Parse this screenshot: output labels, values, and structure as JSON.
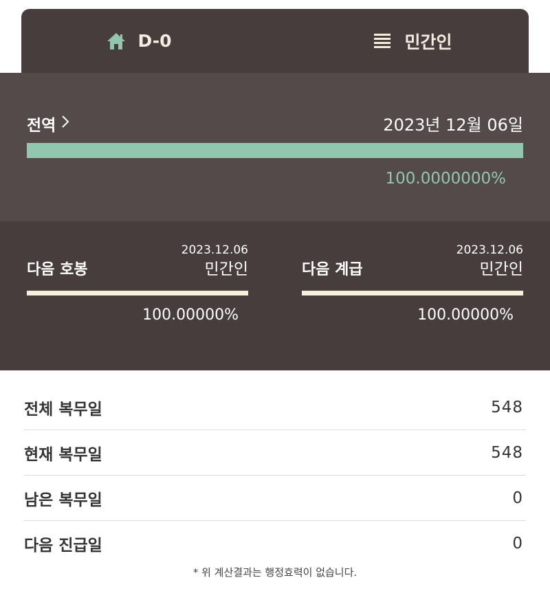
{
  "tabs": {
    "dday": {
      "label": "D-0",
      "icon": "home-icon"
    },
    "status": {
      "label": "민간인",
      "icon": "list-icon"
    }
  },
  "colors": {
    "accent_green": "#91c7ae",
    "panel_dark": "#473d3d",
    "panel_mid": "#544a4a",
    "cream": "#f7efdc"
  },
  "main": {
    "title": "전역",
    "date": "2023년 12월 06일",
    "progress_percent": 100,
    "progress_text": "100.0000000%"
  },
  "next_pay": {
    "title": "다음 호봉",
    "date": "2023.12.06",
    "status": "민간인",
    "progress_percent": 100,
    "progress_text": "100.00000%"
  },
  "next_rank": {
    "title": "다음 계급",
    "date": "2023.12.06",
    "status": "민간인",
    "progress_percent": 100,
    "progress_text": "100.00000%"
  },
  "stats": [
    {
      "label": "전체 복무일",
      "value": "548"
    },
    {
      "label": "현재 복무일",
      "value": "548"
    },
    {
      "label": "남은 복무일",
      "value": "0"
    },
    {
      "label": "다음 진급일",
      "value": "0"
    }
  ],
  "footnote": "* 위 계산결과는 행정효력이 없습니다."
}
